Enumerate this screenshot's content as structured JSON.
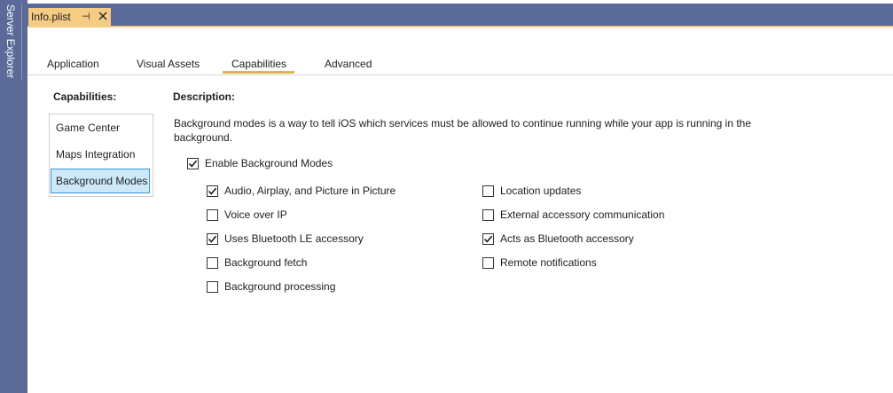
{
  "sidebar": {
    "label": "Server Explorer"
  },
  "document_tab": {
    "title": "Info.plist",
    "pin_glyph": "⊣",
    "close_glyph": "✕"
  },
  "tabs": [
    {
      "label": "Application"
    },
    {
      "label": "Visual Assets"
    },
    {
      "label": "Capabilities",
      "active": true
    },
    {
      "label": "Advanced"
    }
  ],
  "capabilities": {
    "title": "Capabilities:",
    "items": [
      {
        "label": "Game Center"
      },
      {
        "label": "Maps Integration"
      },
      {
        "label": "Background Modes",
        "selected": true
      }
    ]
  },
  "description": {
    "title": "Description:",
    "text": "Background modes is a way to tell iOS which services must be allowed to continue running while your app is running in the background."
  },
  "enable": {
    "label": "Enable Background Modes",
    "checked": true
  },
  "modes_left": [
    {
      "label": "Audio, Airplay, and Picture in Picture",
      "checked": true
    },
    {
      "label": "Voice over IP",
      "checked": false
    },
    {
      "label": "Uses Bluetooth LE accessory",
      "checked": true
    },
    {
      "label": "Background fetch",
      "checked": false
    },
    {
      "label": "Background processing",
      "checked": false
    }
  ],
  "modes_right": [
    {
      "label": "Location updates",
      "checked": false
    },
    {
      "label": "External accessory communication",
      "checked": false
    },
    {
      "label": "Acts as Bluetooth accessory",
      "checked": true
    },
    {
      "label": "Remote notifications",
      "checked": false
    }
  ],
  "colors": {
    "chrome": "#5c6a99",
    "active_tab": "#f5cc84",
    "tab_underline": "#e3b34f",
    "selection": "#cde8f8",
    "selection_border": "#3a95d8"
  }
}
